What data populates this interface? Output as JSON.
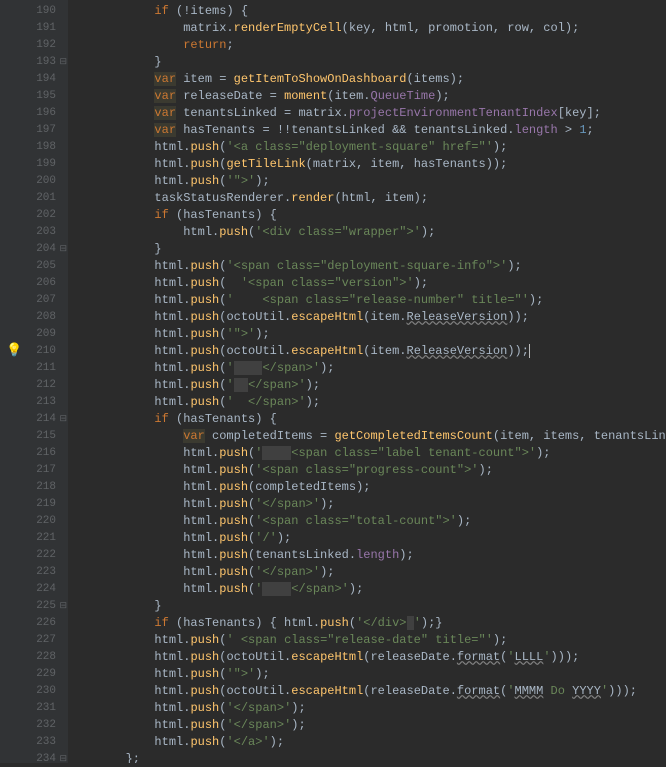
{
  "lines": [
    {
      "n": 190,
      "indent": "            ",
      "tokens": [
        {
          "t": "if",
          "c": "kw"
        },
        {
          "t": " (!items) {",
          "c": "op"
        }
      ]
    },
    {
      "n": 191,
      "indent": "                ",
      "tokens": [
        {
          "t": "matrix.",
          "c": "op"
        },
        {
          "t": "renderEmptyCell",
          "c": "fn"
        },
        {
          "t": "(key, html, promotion, row, col);",
          "c": "op"
        }
      ]
    },
    {
      "n": 192,
      "indent": "                ",
      "tokens": [
        {
          "t": "return",
          "c": "kw"
        },
        {
          "t": ";",
          "c": "op"
        }
      ]
    },
    {
      "n": 193,
      "fold": "-",
      "indent": "            ",
      "tokens": [
        {
          "t": "}",
          "c": "op"
        }
      ]
    },
    {
      "n": 194,
      "indent": "            ",
      "tokens": [
        {
          "t": "var",
          "c": "var"
        },
        {
          "t": " item = ",
          "c": "op"
        },
        {
          "t": "getItemToShowOnDashboard",
          "c": "fn"
        },
        {
          "t": "(items);",
          "c": "op"
        }
      ]
    },
    {
      "n": 195,
      "indent": "            ",
      "tokens": [
        {
          "t": "var",
          "c": "var"
        },
        {
          "t": " releaseDate = ",
          "c": "op"
        },
        {
          "t": "moment",
          "c": "fn"
        },
        {
          "t": "(item.",
          "c": "op"
        },
        {
          "t": "QueueTime",
          "c": "prop"
        },
        {
          "t": ");",
          "c": "op"
        }
      ]
    },
    {
      "n": 196,
      "indent": "            ",
      "tokens": [
        {
          "t": "var",
          "c": "var"
        },
        {
          "t": " tenantsLinked = matrix.",
          "c": "op"
        },
        {
          "t": "projectEnvironmentTenantIndex",
          "c": "prop"
        },
        {
          "t": "[key];",
          "c": "op"
        }
      ]
    },
    {
      "n": 197,
      "indent": "            ",
      "tokens": [
        {
          "t": "var",
          "c": "var"
        },
        {
          "t": " hasTenants = !!tenantsLinked && tenantsLinked.",
          "c": "op"
        },
        {
          "t": "length",
          "c": "prop"
        },
        {
          "t": " > ",
          "c": "op"
        },
        {
          "t": "1",
          "c": "num"
        },
        {
          "t": ";",
          "c": "op"
        }
      ]
    },
    {
      "n": 198,
      "indent": "            ",
      "tokens": [
        {
          "t": "html.",
          "c": "op"
        },
        {
          "t": "push",
          "c": "fn"
        },
        {
          "t": "(",
          "c": "op"
        },
        {
          "t": "'<a class=\"deployment-square\" href=\"'",
          "c": "str"
        },
        {
          "t": ");",
          "c": "op"
        }
      ]
    },
    {
      "n": 199,
      "indent": "            ",
      "tokens": [
        {
          "t": "html.",
          "c": "op"
        },
        {
          "t": "push",
          "c": "fn"
        },
        {
          "t": "(",
          "c": "op"
        },
        {
          "t": "getTileLink",
          "c": "fn"
        },
        {
          "t": "(matrix, item, hasTenants));",
          "c": "op"
        }
      ]
    },
    {
      "n": 200,
      "indent": "            ",
      "tokens": [
        {
          "t": "html.",
          "c": "op"
        },
        {
          "t": "push",
          "c": "fn"
        },
        {
          "t": "(",
          "c": "op"
        },
        {
          "t": "'\">'",
          "c": "str"
        },
        {
          "t": ");",
          "c": "op"
        }
      ]
    },
    {
      "n": 201,
      "indent": "            ",
      "tokens": [
        {
          "t": "taskStatusRenderer.",
          "c": "op"
        },
        {
          "t": "render",
          "c": "fn"
        },
        {
          "t": "(html, item);",
          "c": "op"
        }
      ]
    },
    {
      "n": 202,
      "indent": "            ",
      "tokens": [
        {
          "t": "if",
          "c": "kw"
        },
        {
          "t": " (hasTenants) {",
          "c": "op"
        }
      ]
    },
    {
      "n": 203,
      "indent": "                ",
      "tokens": [
        {
          "t": "html.",
          "c": "op"
        },
        {
          "t": "push",
          "c": "fn"
        },
        {
          "t": "(",
          "c": "op"
        },
        {
          "t": "'<div class=\"wrapper\">'",
          "c": "str"
        },
        {
          "t": ");",
          "c": "op"
        }
      ]
    },
    {
      "n": 204,
      "fold": "-",
      "indent": "            ",
      "tokens": [
        {
          "t": "}",
          "c": "op"
        }
      ]
    },
    {
      "n": 205,
      "indent": "            ",
      "tokens": [
        {
          "t": "html.",
          "c": "op"
        },
        {
          "t": "push",
          "c": "fn"
        },
        {
          "t": "(",
          "c": "op"
        },
        {
          "t": "'<span class=\"deployment-square-info\">'",
          "c": "str"
        },
        {
          "t": ");",
          "c": "op"
        }
      ]
    },
    {
      "n": 206,
      "indent": "            ",
      "tokens": [
        {
          "t": "html.",
          "c": "op"
        },
        {
          "t": "push",
          "c": "fn"
        },
        {
          "t": "(  ",
          "c": "op"
        },
        {
          "t": "'<span class=\"version\">'",
          "c": "str"
        },
        {
          "t": ");",
          "c": "op"
        }
      ]
    },
    {
      "n": 207,
      "indent": "            ",
      "tokens": [
        {
          "t": "html.",
          "c": "op"
        },
        {
          "t": "push",
          "c": "fn"
        },
        {
          "t": "(",
          "c": "op"
        },
        {
          "t": "'    <span class=\"release-number\" title=\"'",
          "c": "str"
        },
        {
          "t": ");",
          "c": "op"
        }
      ]
    },
    {
      "n": 208,
      "indent": "            ",
      "tokens": [
        {
          "t": "html.",
          "c": "op"
        },
        {
          "t": "push",
          "c": "fn"
        },
        {
          "t": "(octoUtil.",
          "c": "op"
        },
        {
          "t": "escapeHtml",
          "c": "fn"
        },
        {
          "t": "(item.",
          "c": "op"
        },
        {
          "t": "ReleaseVersion",
          "c": "warn"
        },
        {
          "t": "));",
          "c": "op"
        }
      ]
    },
    {
      "n": 209,
      "indent": "            ",
      "tokens": [
        {
          "t": "html.",
          "c": "op"
        },
        {
          "t": "push",
          "c": "fn"
        },
        {
          "t": "(",
          "c": "op"
        },
        {
          "t": "'\">'",
          "c": "str"
        },
        {
          "t": ");",
          "c": "op"
        }
      ]
    },
    {
      "n": 210,
      "bulb": true,
      "indent": "            ",
      "tokens": [
        {
          "t": "html.",
          "c": "op"
        },
        {
          "t": "push",
          "c": "fn"
        },
        {
          "t": "(octoUtil.",
          "c": "op"
        },
        {
          "t": "escapeHtml",
          "c": "fn"
        },
        {
          "t": "(item.",
          "c": "op"
        },
        {
          "t": "ReleaseVersion",
          "c": "warn"
        },
        {
          "t": "));",
          "c": "op"
        },
        {
          "t": "",
          "c": "cursor"
        }
      ]
    },
    {
      "n": 211,
      "indent": "            ",
      "tokens": [
        {
          "t": "html.",
          "c": "op"
        },
        {
          "t": "push",
          "c": "fn"
        },
        {
          "t": "(",
          "c": "op"
        },
        {
          "t": "'",
          "c": "str"
        },
        {
          "t": "    ",
          "c": "sel"
        },
        {
          "t": "</span>'",
          "c": "str"
        },
        {
          "t": ");",
          "c": "op"
        }
      ]
    },
    {
      "n": 212,
      "indent": "            ",
      "tokens": [
        {
          "t": "html.",
          "c": "op"
        },
        {
          "t": "push",
          "c": "fn"
        },
        {
          "t": "(",
          "c": "op"
        },
        {
          "t": "'",
          "c": "str"
        },
        {
          "t": "  ",
          "c": "sel"
        },
        {
          "t": "</span>'",
          "c": "str"
        },
        {
          "t": ");",
          "c": "op"
        }
      ]
    },
    {
      "n": 213,
      "indent": "            ",
      "tokens": [
        {
          "t": "html.",
          "c": "op"
        },
        {
          "t": "push",
          "c": "fn"
        },
        {
          "t": "(",
          "c": "op"
        },
        {
          "t": "'  </span>'",
          "c": "str"
        },
        {
          "t": ");",
          "c": "op"
        }
      ]
    },
    {
      "n": 214,
      "fold": "-",
      "indent": "            ",
      "tokens": [
        {
          "t": "if",
          "c": "kw"
        },
        {
          "t": " (hasTenants) {",
          "c": "op"
        }
      ]
    },
    {
      "n": 215,
      "indent": "                ",
      "tokens": [
        {
          "t": "var",
          "c": "var"
        },
        {
          "t": " completedItems = ",
          "c": "op"
        },
        {
          "t": "getCompletedItemsCount",
          "c": "fn"
        },
        {
          "t": "(item, items, tenantsLinked);",
          "c": "op"
        }
      ]
    },
    {
      "n": 216,
      "indent": "                ",
      "tokens": [
        {
          "t": "html.",
          "c": "op"
        },
        {
          "t": "push",
          "c": "fn"
        },
        {
          "t": "(",
          "c": "op"
        },
        {
          "t": "'",
          "c": "str"
        },
        {
          "t": "    ",
          "c": "sel"
        },
        {
          "t": "<span class=\"label tenant-count\">'",
          "c": "str"
        },
        {
          "t": ");",
          "c": "op"
        }
      ]
    },
    {
      "n": 217,
      "indent": "                ",
      "tokens": [
        {
          "t": "html.",
          "c": "op"
        },
        {
          "t": "push",
          "c": "fn"
        },
        {
          "t": "(",
          "c": "op"
        },
        {
          "t": "'<span class=\"progress-count\">'",
          "c": "str"
        },
        {
          "t": ");",
          "c": "op"
        }
      ]
    },
    {
      "n": 218,
      "indent": "                ",
      "tokens": [
        {
          "t": "html.",
          "c": "op"
        },
        {
          "t": "push",
          "c": "fn"
        },
        {
          "t": "(completedItems);",
          "c": "op"
        }
      ]
    },
    {
      "n": 219,
      "indent": "                ",
      "tokens": [
        {
          "t": "html.",
          "c": "op"
        },
        {
          "t": "push",
          "c": "fn"
        },
        {
          "t": "(",
          "c": "op"
        },
        {
          "t": "'</span>'",
          "c": "str"
        },
        {
          "t": ");",
          "c": "op"
        }
      ]
    },
    {
      "n": 220,
      "indent": "                ",
      "tokens": [
        {
          "t": "html.",
          "c": "op"
        },
        {
          "t": "push",
          "c": "fn"
        },
        {
          "t": "(",
          "c": "op"
        },
        {
          "t": "'<span class=\"total-count\">'",
          "c": "str"
        },
        {
          "t": ");",
          "c": "op"
        }
      ]
    },
    {
      "n": 221,
      "indent": "                ",
      "tokens": [
        {
          "t": "html.",
          "c": "op"
        },
        {
          "t": "push",
          "c": "fn"
        },
        {
          "t": "(",
          "c": "op"
        },
        {
          "t": "'/'",
          "c": "str"
        },
        {
          "t": ");",
          "c": "op"
        }
      ]
    },
    {
      "n": 222,
      "indent": "                ",
      "tokens": [
        {
          "t": "html.",
          "c": "op"
        },
        {
          "t": "push",
          "c": "fn"
        },
        {
          "t": "(tenantsLinked.",
          "c": "op"
        },
        {
          "t": "length",
          "c": "prop"
        },
        {
          "t": ");",
          "c": "op"
        }
      ]
    },
    {
      "n": 223,
      "indent": "                ",
      "tokens": [
        {
          "t": "html.",
          "c": "op"
        },
        {
          "t": "push",
          "c": "fn"
        },
        {
          "t": "(",
          "c": "op"
        },
        {
          "t": "'</span>'",
          "c": "str"
        },
        {
          "t": ");",
          "c": "op"
        }
      ]
    },
    {
      "n": 224,
      "indent": "                ",
      "tokens": [
        {
          "t": "html.",
          "c": "op"
        },
        {
          "t": "push",
          "c": "fn"
        },
        {
          "t": "(",
          "c": "op"
        },
        {
          "t": "'",
          "c": "str"
        },
        {
          "t": "    ",
          "c": "sel"
        },
        {
          "t": "</span>'",
          "c": "str"
        },
        {
          "t": ");",
          "c": "op"
        }
      ]
    },
    {
      "n": 225,
      "fold": "-",
      "indent": "            ",
      "tokens": [
        {
          "t": "}",
          "c": "op"
        }
      ]
    },
    {
      "n": 226,
      "indent": "            ",
      "tokens": [
        {
          "t": "if",
          "c": "kw"
        },
        {
          "t": " (hasTenants) { html.",
          "c": "op"
        },
        {
          "t": "push",
          "c": "fn"
        },
        {
          "t": "(",
          "c": "op"
        },
        {
          "t": "'</div>",
          "c": "str"
        },
        {
          "t": " ",
          "c": "sel"
        },
        {
          "t": "'",
          "c": "str"
        },
        {
          "t": ");}",
          "c": "op"
        }
      ]
    },
    {
      "n": 227,
      "indent": "            ",
      "tokens": [
        {
          "t": "html.",
          "c": "op"
        },
        {
          "t": "push",
          "c": "fn"
        },
        {
          "t": "(",
          "c": "op"
        },
        {
          "t": "' <span class=\"release-date\" title=\"'",
          "c": "str"
        },
        {
          "t": ");",
          "c": "op"
        }
      ]
    },
    {
      "n": 228,
      "indent": "            ",
      "tokens": [
        {
          "t": "html.",
          "c": "op"
        },
        {
          "t": "push",
          "c": "fn"
        },
        {
          "t": "(octoUtil.",
          "c": "op"
        },
        {
          "t": "escapeHtml",
          "c": "fn"
        },
        {
          "t": "(releaseDate.",
          "c": "op"
        },
        {
          "t": "format",
          "c": "warn"
        },
        {
          "t": "(",
          "c": "op"
        },
        {
          "t": "'",
          "c": "str"
        },
        {
          "t": "LLLL",
          "c": "warn"
        },
        {
          "t": "'",
          "c": "str"
        },
        {
          "t": ")));",
          "c": "op"
        }
      ]
    },
    {
      "n": 229,
      "indent": "            ",
      "tokens": [
        {
          "t": "html.",
          "c": "op"
        },
        {
          "t": "push",
          "c": "fn"
        },
        {
          "t": "(",
          "c": "op"
        },
        {
          "t": "'\">'",
          "c": "str"
        },
        {
          "t": ");",
          "c": "op"
        }
      ]
    },
    {
      "n": 230,
      "indent": "            ",
      "tokens": [
        {
          "t": "html.",
          "c": "op"
        },
        {
          "t": "push",
          "c": "fn"
        },
        {
          "t": "(octoUtil.",
          "c": "op"
        },
        {
          "t": "escapeHtml",
          "c": "fn"
        },
        {
          "t": "(releaseDate.",
          "c": "op"
        },
        {
          "t": "format",
          "c": "warn"
        },
        {
          "t": "(",
          "c": "op"
        },
        {
          "t": "'",
          "c": "str"
        },
        {
          "t": "MMMM",
          "c": "warn"
        },
        {
          "t": " Do ",
          "c": "str"
        },
        {
          "t": "YYYY",
          "c": "warn"
        },
        {
          "t": "'",
          "c": "str"
        },
        {
          "t": ")));",
          "c": "op"
        }
      ]
    },
    {
      "n": 231,
      "indent": "            ",
      "tokens": [
        {
          "t": "html.",
          "c": "op"
        },
        {
          "t": "push",
          "c": "fn"
        },
        {
          "t": "(",
          "c": "op"
        },
        {
          "t": "'</span>'",
          "c": "str"
        },
        {
          "t": ");",
          "c": "op"
        }
      ]
    },
    {
      "n": 232,
      "indent": "            ",
      "tokens": [
        {
          "t": "html.",
          "c": "op"
        },
        {
          "t": "push",
          "c": "fn"
        },
        {
          "t": "(",
          "c": "op"
        },
        {
          "t": "'</span>'",
          "c": "str"
        },
        {
          "t": ");",
          "c": "op"
        }
      ]
    },
    {
      "n": 233,
      "indent": "            ",
      "tokens": [
        {
          "t": "html.",
          "c": "op"
        },
        {
          "t": "push",
          "c": "fn"
        },
        {
          "t": "(",
          "c": "op"
        },
        {
          "t": "'</a>'",
          "c": "str"
        },
        {
          "t": ");",
          "c": "op"
        }
      ]
    },
    {
      "n": 234,
      "fold": "-",
      "indent": "        ",
      "tokens": [
        {
          "t": "};",
          "c": "op"
        }
      ]
    }
  ]
}
